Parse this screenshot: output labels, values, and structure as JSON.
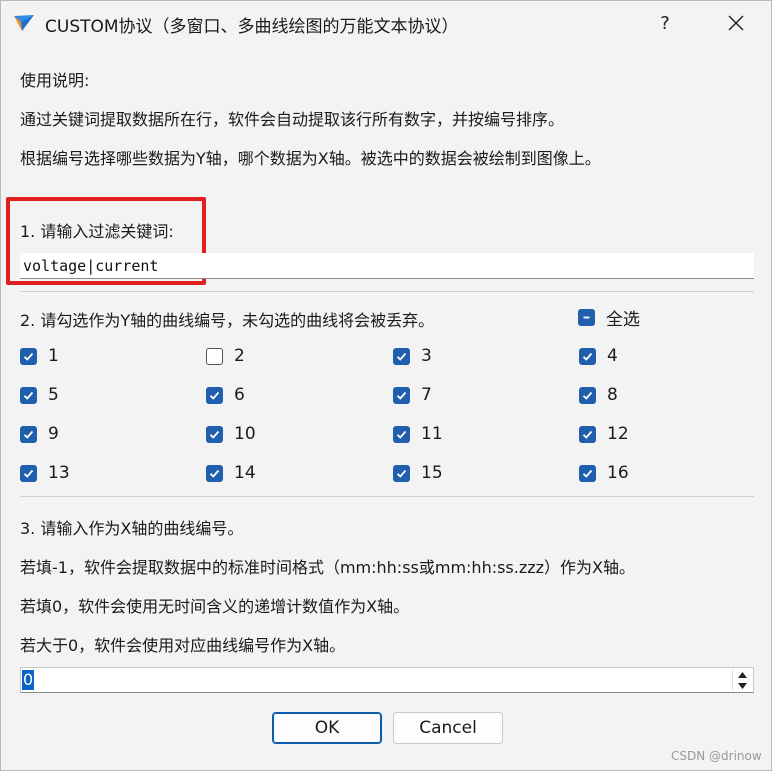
{
  "window": {
    "title": "CUSTOM协议（多窗口、多曲线绘图的万能文本协议）",
    "help_label": "?"
  },
  "instructions": {
    "heading": "使用说明:",
    "line1": "通过关键词提取数据所在行，软件会自动提取该行所有数字，并按编号排序。",
    "line2": "根据编号选择哪些数据为Y轴，哪个数据为X轴。被选中的数据会被绘制到图像上。"
  },
  "section1": {
    "label": "1. 请输入过滤关键词:",
    "value": "voltage|current"
  },
  "section2": {
    "label": "2. 请勾选作为Y轴的曲线编号，未勾选的曲线将会被丢弃。",
    "select_all_label": "全选",
    "select_all_state": "partial",
    "curves": [
      {
        "label": "1",
        "checked": true
      },
      {
        "label": "2",
        "checked": false
      },
      {
        "label": "3",
        "checked": true
      },
      {
        "label": "4",
        "checked": true
      },
      {
        "label": "5",
        "checked": true
      },
      {
        "label": "6",
        "checked": true
      },
      {
        "label": "7",
        "checked": true
      },
      {
        "label": "8",
        "checked": true
      },
      {
        "label": "9",
        "checked": true
      },
      {
        "label": "10",
        "checked": true
      },
      {
        "label": "11",
        "checked": true
      },
      {
        "label": "12",
        "checked": true
      },
      {
        "label": "13",
        "checked": true
      },
      {
        "label": "14",
        "checked": true
      },
      {
        "label": "15",
        "checked": true
      },
      {
        "label": "16",
        "checked": true
      }
    ]
  },
  "section3": {
    "label": "3. 请输入作为X轴的曲线编号。",
    "note1": "若填-1，软件会提取数据中的标准时间格式（mm:hh:ss或mm:hh:ss.zzz）作为X轴。",
    "note2": "若填0，软件会使用无时间含义的递增计数值作为X轴。",
    "note3": "若大于0，软件会使用对应曲线编号作为X轴。",
    "value": "0"
  },
  "buttons": {
    "ok": "OK",
    "cancel": "Cancel"
  },
  "watermark": "CSDN @drinow",
  "colors": {
    "accent": "#1f5fae",
    "highlight_border": "#e02020"
  }
}
